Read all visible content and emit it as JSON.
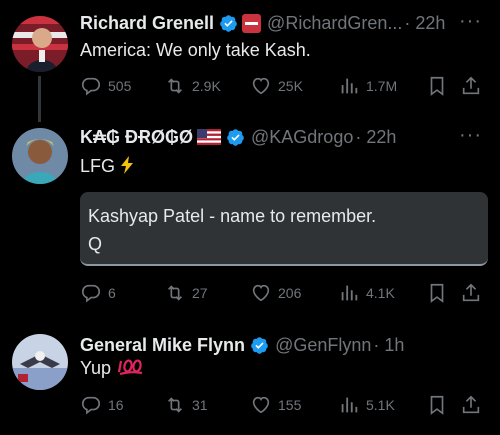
{
  "tweets": [
    {
      "name": "Richard Grenell",
      "handle": "@RichardGren...",
      "time": "· 22h",
      "text": "America: We only take Kash.",
      "replies": "505",
      "retweets": "2.9K",
      "likes": "25K",
      "views": "1.7M"
    },
    {
      "name": "K₳₲ ĐɌØ₲Ø",
      "handle": "@KAGdrogo",
      "time": "· 22h",
      "text": "LFG",
      "quote_line1": "Kashyap Patel - name to remember.",
      "quote_line2": "Q",
      "replies": "6",
      "retweets": "27",
      "likes": "206",
      "views": "4.1K"
    },
    {
      "name": "General Mike Flynn",
      "handle": "@GenFlynn",
      "time": "· 1h",
      "text": "Yup",
      "replies": "16",
      "retweets": "31",
      "likes": "155",
      "views": "5.1K"
    }
  ],
  "icons": {
    "more": "more-icon",
    "reply": "reply-icon",
    "retweet": "retweet-icon",
    "like": "heart-icon",
    "views": "views-icon",
    "bookmark": "bookmark-icon",
    "share": "share-icon"
  },
  "colors": {
    "background": "#000000",
    "text": "#e7e9ea",
    "muted": "#71767b",
    "verified": "#1d9bf0"
  }
}
